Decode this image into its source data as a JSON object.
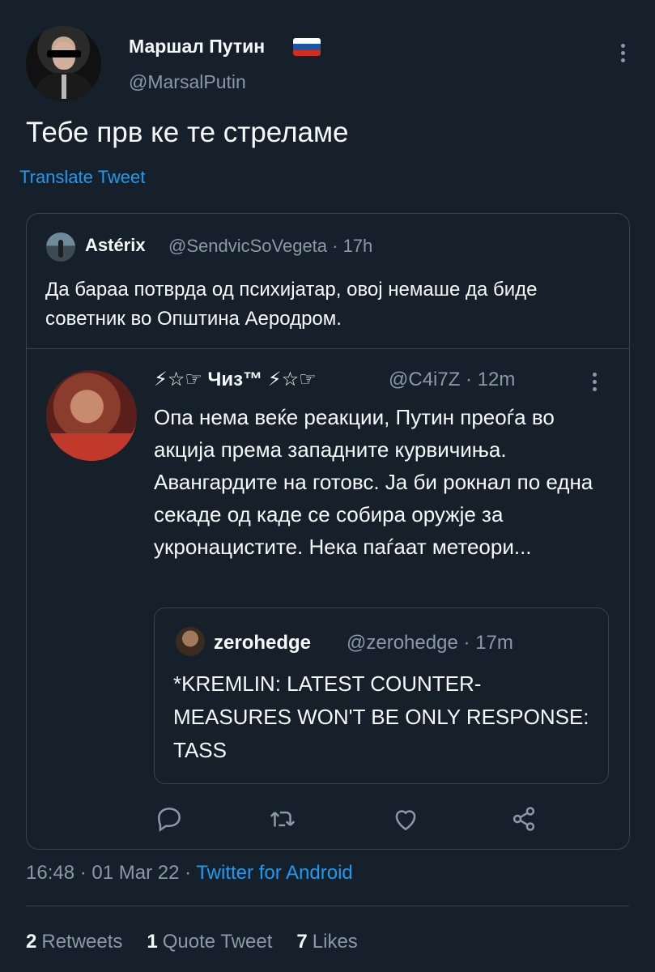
{
  "author": {
    "name": "Маршал Путин",
    "handle": "@MarsalPutin",
    "flag_colors": [
      "#ffffff",
      "#1c57a5",
      "#d52b1e"
    ]
  },
  "tweet": {
    "text": "Тебе прв ке те стреламе",
    "translate_label": "Translate Tweet"
  },
  "quoted": {
    "name": "Astérix",
    "handle": "@SendvicSoVegeta · 17h",
    "text": "Да бараа потврда од психијатар, овој немаше да биде советник во Општина Аеродром."
  },
  "reply": {
    "name": "⚡☆☞ Чиз™ ⚡☆☞",
    "handle": "@C4i7Z · 12m",
    "text": "Опа нема веќе реакции, Путин преоѓа во акција према западните курвичиња. Авангардите на готовс. Ја би рокнал по една секаде од каде се собира оружје за укронацистите. Нека паѓаат метеори..."
  },
  "inner_quote": {
    "name": "zerohedge",
    "handle": "@zerohedge · 17m",
    "text": "*KREMLIN: LATEST COUNTER-MEASURES WON'T BE ONLY RESPONSE: TASS"
  },
  "actions": [
    "reply-icon",
    "retweet-icon",
    "like-icon",
    "share-icon"
  ],
  "meta": {
    "time": "16:48 · 01 Mar 22 · ",
    "source": "Twitter for Android"
  },
  "stats": {
    "retweets_count": "2",
    "retweets_label": "Retweets",
    "quotes_count": "1",
    "quotes_label": "Quote Tweet",
    "likes_count": "7",
    "likes_label": "Likes"
  },
  "colors": {
    "background": "#15202b",
    "accent": "#1d9bf0",
    "muted": "#8b98a5",
    "border": "#38444d"
  }
}
